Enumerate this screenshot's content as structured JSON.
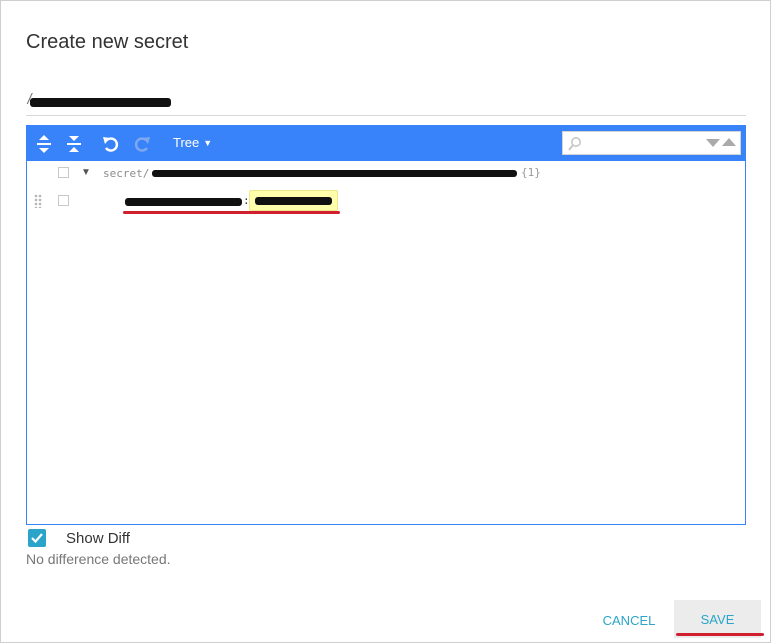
{
  "dialog": {
    "title": "Create new secret"
  },
  "path_field": {
    "visible_prefix": "/"
  },
  "editor": {
    "mode_label": "Tree",
    "search_placeholder": "",
    "tree": {
      "root_label": "secret/",
      "root_count": "{1}",
      "field_colon": ":"
    }
  },
  "show_diff": {
    "label": "Show Diff",
    "checked": true,
    "status": "No difference detected."
  },
  "actions": {
    "cancel_label": "CANCEL",
    "save_label": "SAVE"
  },
  "colors": {
    "menu_blue": "#3883fa",
    "accent_teal": "#2aa5c9",
    "annotation_red": "#d0202e",
    "value_highlight": "#ffffab"
  },
  "icons": {
    "expand_all": "expand-all-icon",
    "collapse_all": "collapse-all-icon",
    "undo": "undo-icon",
    "redo": "redo-icon",
    "search": "search-icon"
  }
}
